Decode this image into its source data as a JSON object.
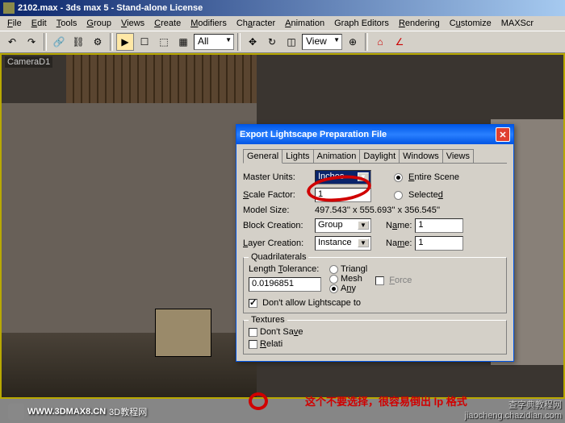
{
  "window": {
    "title": "2102.max - 3ds max 5 - Stand-alone License"
  },
  "menu": [
    "File",
    "Edit",
    "Tools",
    "Group",
    "Views",
    "Create",
    "Modifiers",
    "Character",
    "Animation",
    "Graph Editors",
    "Rendering",
    "Customize",
    "MAXScr"
  ],
  "toolbar": {
    "combo1": "All",
    "combo2": "View"
  },
  "viewport": {
    "label": "CameraD1"
  },
  "dialog": {
    "title": "Export Lightscape Preparation File",
    "tabs": [
      "General",
      "Lights",
      "Animation",
      "Daylight",
      "Windows",
      "Views"
    ],
    "master_units_label": "Master Units:",
    "master_units_value": "Inches",
    "scale_factor_label": "Scale Factor:",
    "scale_factor_value": "1",
    "entire_scene": "Entire Scene",
    "selected": "Selected",
    "model_size_label": "Model Size:",
    "model_size_value": "497.543'' x 555.693'' x 356.545''",
    "block_creation_label": "Block Creation:",
    "block_creation_value": "Group",
    "layer_creation_label": "Layer Creation:",
    "layer_creation_value": "Instance",
    "name_label": "Name:",
    "name1_value": "1",
    "name2_value": "1",
    "quads": {
      "title": "Quadrilaterals",
      "length_tol_label": "Length Tolerance:",
      "length_tol_value": "0.0196851",
      "triangl": "Triangl",
      "mesh": "Mesh",
      "any": "Any",
      "force": "Force",
      "dont_allow": "Don't allow Lightscape to"
    },
    "textures": {
      "title": "Textures",
      "dont_save": "Don't Save",
      "relative": "Relative Text"
    }
  },
  "annotation": "这个不要选择，很容易倒出 lp 格式",
  "watermark": {
    "left_url": "WWW.3DMAX8.CN",
    "left_sub": "3D教程网",
    "right1": "查字典教程网",
    "right2": "jiaocheng.chazidian.com"
  }
}
